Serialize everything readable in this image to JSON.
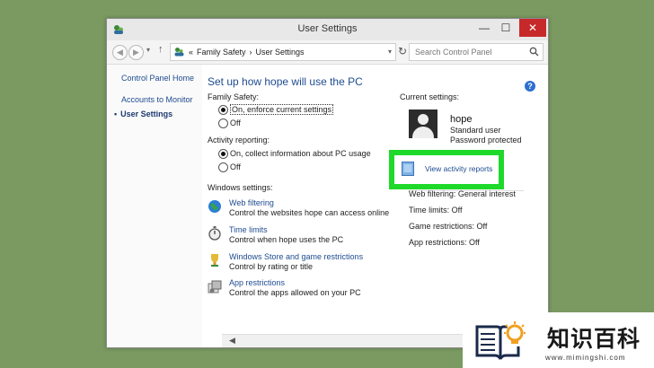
{
  "window": {
    "title": "User Settings",
    "minimize": "—",
    "maximize": "☐",
    "close": "✕"
  },
  "navbar": {
    "breadcrumb_prefix": "«",
    "breadcrumbs": [
      "Family Safety",
      "›",
      "User Settings"
    ],
    "search_placeholder": "Search Control Panel"
  },
  "left_nav": {
    "items": [
      "Control Panel Home",
      "Accounts to Monitor",
      "User Settings"
    ],
    "current": "User Settings"
  },
  "main": {
    "heading": "Set up how hope will use the PC",
    "family_safety": {
      "label": "Family Safety:",
      "options": [
        "On, enforce current settings",
        "Off"
      ],
      "selected": "On, enforce current settings"
    },
    "activity_reporting": {
      "label": "Activity reporting:",
      "options": [
        "On, collect information about PC usage",
        "Off"
      ],
      "selected": "On, collect information about PC usage"
    },
    "windows_settings": {
      "label": "Windows settings:",
      "items": [
        {
          "icon": "globe-icon",
          "link": "Web filtering",
          "desc": "Control the websites hope can access online"
        },
        {
          "icon": "stopwatch-icon",
          "link": "Time limits",
          "desc": "Control when hope uses the PC"
        },
        {
          "icon": "trophy-icon",
          "link": "Windows Store and game restrictions",
          "desc": "Control by rating or title"
        },
        {
          "icon": "app-icon",
          "link": "App restrictions",
          "desc": "Control the apps allowed on your PC"
        }
      ]
    }
  },
  "current_settings": {
    "label": "Current settings:",
    "user": {
      "name": "hope",
      "type": "Standard user",
      "password": "Password protected"
    },
    "report_link": "View activity reports",
    "lines": [
      "Web filtering: General interest",
      "Time limits: Off",
      "Game restrictions: Off",
      "App restrictions: Off"
    ]
  },
  "help_icon": "?",
  "watermark": {
    "name": "知识百科",
    "url": "www.mimingshi.com"
  },
  "colors": {
    "highlight": "#1fd92a",
    "link": "#1e4b8f",
    "close": "#c7282a"
  }
}
